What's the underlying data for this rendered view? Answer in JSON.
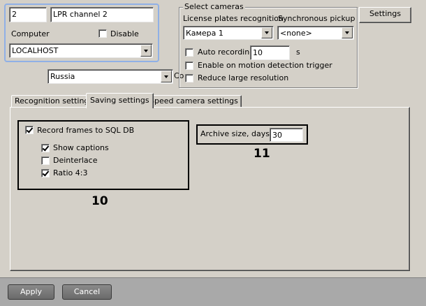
{
  "camera": {
    "number": "2",
    "name": "LPR channel 2",
    "computer_label": "Computer",
    "disable_label": "Disable",
    "disable_checked": false,
    "computer_value": "LOCALHOST",
    "country_value": "Russia",
    "country_suffix_label": "Co"
  },
  "select_cameras": {
    "title": "Select cameras",
    "lpr_label": "License plates recognition",
    "sync_label": "Synchronous pickup",
    "lpr_value": "Камера 1",
    "sync_value": "<none>",
    "auto_recording_label": "Auto recording",
    "auto_recording_checked": false,
    "auto_recording_value": "10",
    "auto_recording_unit": "s",
    "motion_trigger_label": "Enable on motion detection trigger",
    "motion_trigger_checked": false,
    "reduce_resolution_label": "Reduce large resolution",
    "reduce_resolution_checked": false
  },
  "settings_button": "Settings",
  "tabs": [
    {
      "label": "Recognition settings",
      "active": false
    },
    {
      "label": "Saving settings",
      "active": true
    },
    {
      "label": "Speed camera settings",
      "active": false
    }
  ],
  "saving": {
    "record_frames_label": "Record frames to SQL DB",
    "record_frames_checked": true,
    "show_captions_label": "Show captions",
    "show_captions_checked": true,
    "deinterlace_label": "Deinterlace",
    "deinterlace_checked": false,
    "ratio_label": "Ratio 4:3",
    "ratio_checked": true,
    "archive_label": "Archive size, days:",
    "archive_value": "30"
  },
  "annotations": {
    "callout_10": "10",
    "callout_11": "11"
  },
  "footer": {
    "apply": "Apply",
    "cancel": "Cancel"
  }
}
